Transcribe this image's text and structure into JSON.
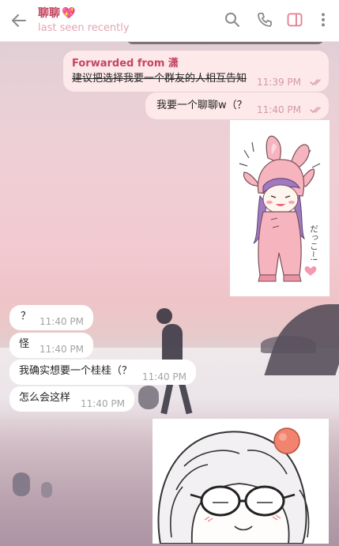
{
  "header": {
    "title": "聊聊",
    "title_emoji": "💖",
    "status": "last seen recently"
  },
  "icons": {
    "back": "arrow-left-icon",
    "search": "search-icon",
    "call": "phone-icon",
    "sidebar": "sidebar-toggle-icon",
    "more": "more-vertical-icon",
    "read": "double-check-icon"
  },
  "colors": {
    "accent": "#c0405a",
    "accent_light": "#e3a6b4",
    "outgoing_bubble": "#fde8ea",
    "incoming_bubble": "#ffffff",
    "sidebar_icon": "#e87a8c"
  },
  "messages": [
    {
      "direction": "out",
      "forwarded_label": "Forwarded from 潇",
      "text": "建议把选择我要一个群友的人相互告知",
      "time": "11:39 PM",
      "read": true
    },
    {
      "direction": "out",
      "text": "我要一个聊聊w（？",
      "time": "11:40 PM",
      "read": true
    },
    {
      "direction": "out",
      "type": "sticker",
      "description": "pink-bunny-hood-chibi-sticker"
    },
    {
      "direction": "in",
      "text": "？",
      "time": "11:40 PM"
    },
    {
      "direction": "in",
      "text": "怪",
      "time": "11:40 PM"
    },
    {
      "direction": "in",
      "text": "我确实想要一个桂桂（？",
      "time": "11:40 PM"
    },
    {
      "direction": "in",
      "text": "怎么会这样",
      "time": "11:40 PM"
    },
    {
      "direction": "out",
      "type": "sticker",
      "description": "white-hair-glasses-chibi-sticker"
    }
  ],
  "stickers": {
    "bunny_text": "だっこ~!"
  }
}
